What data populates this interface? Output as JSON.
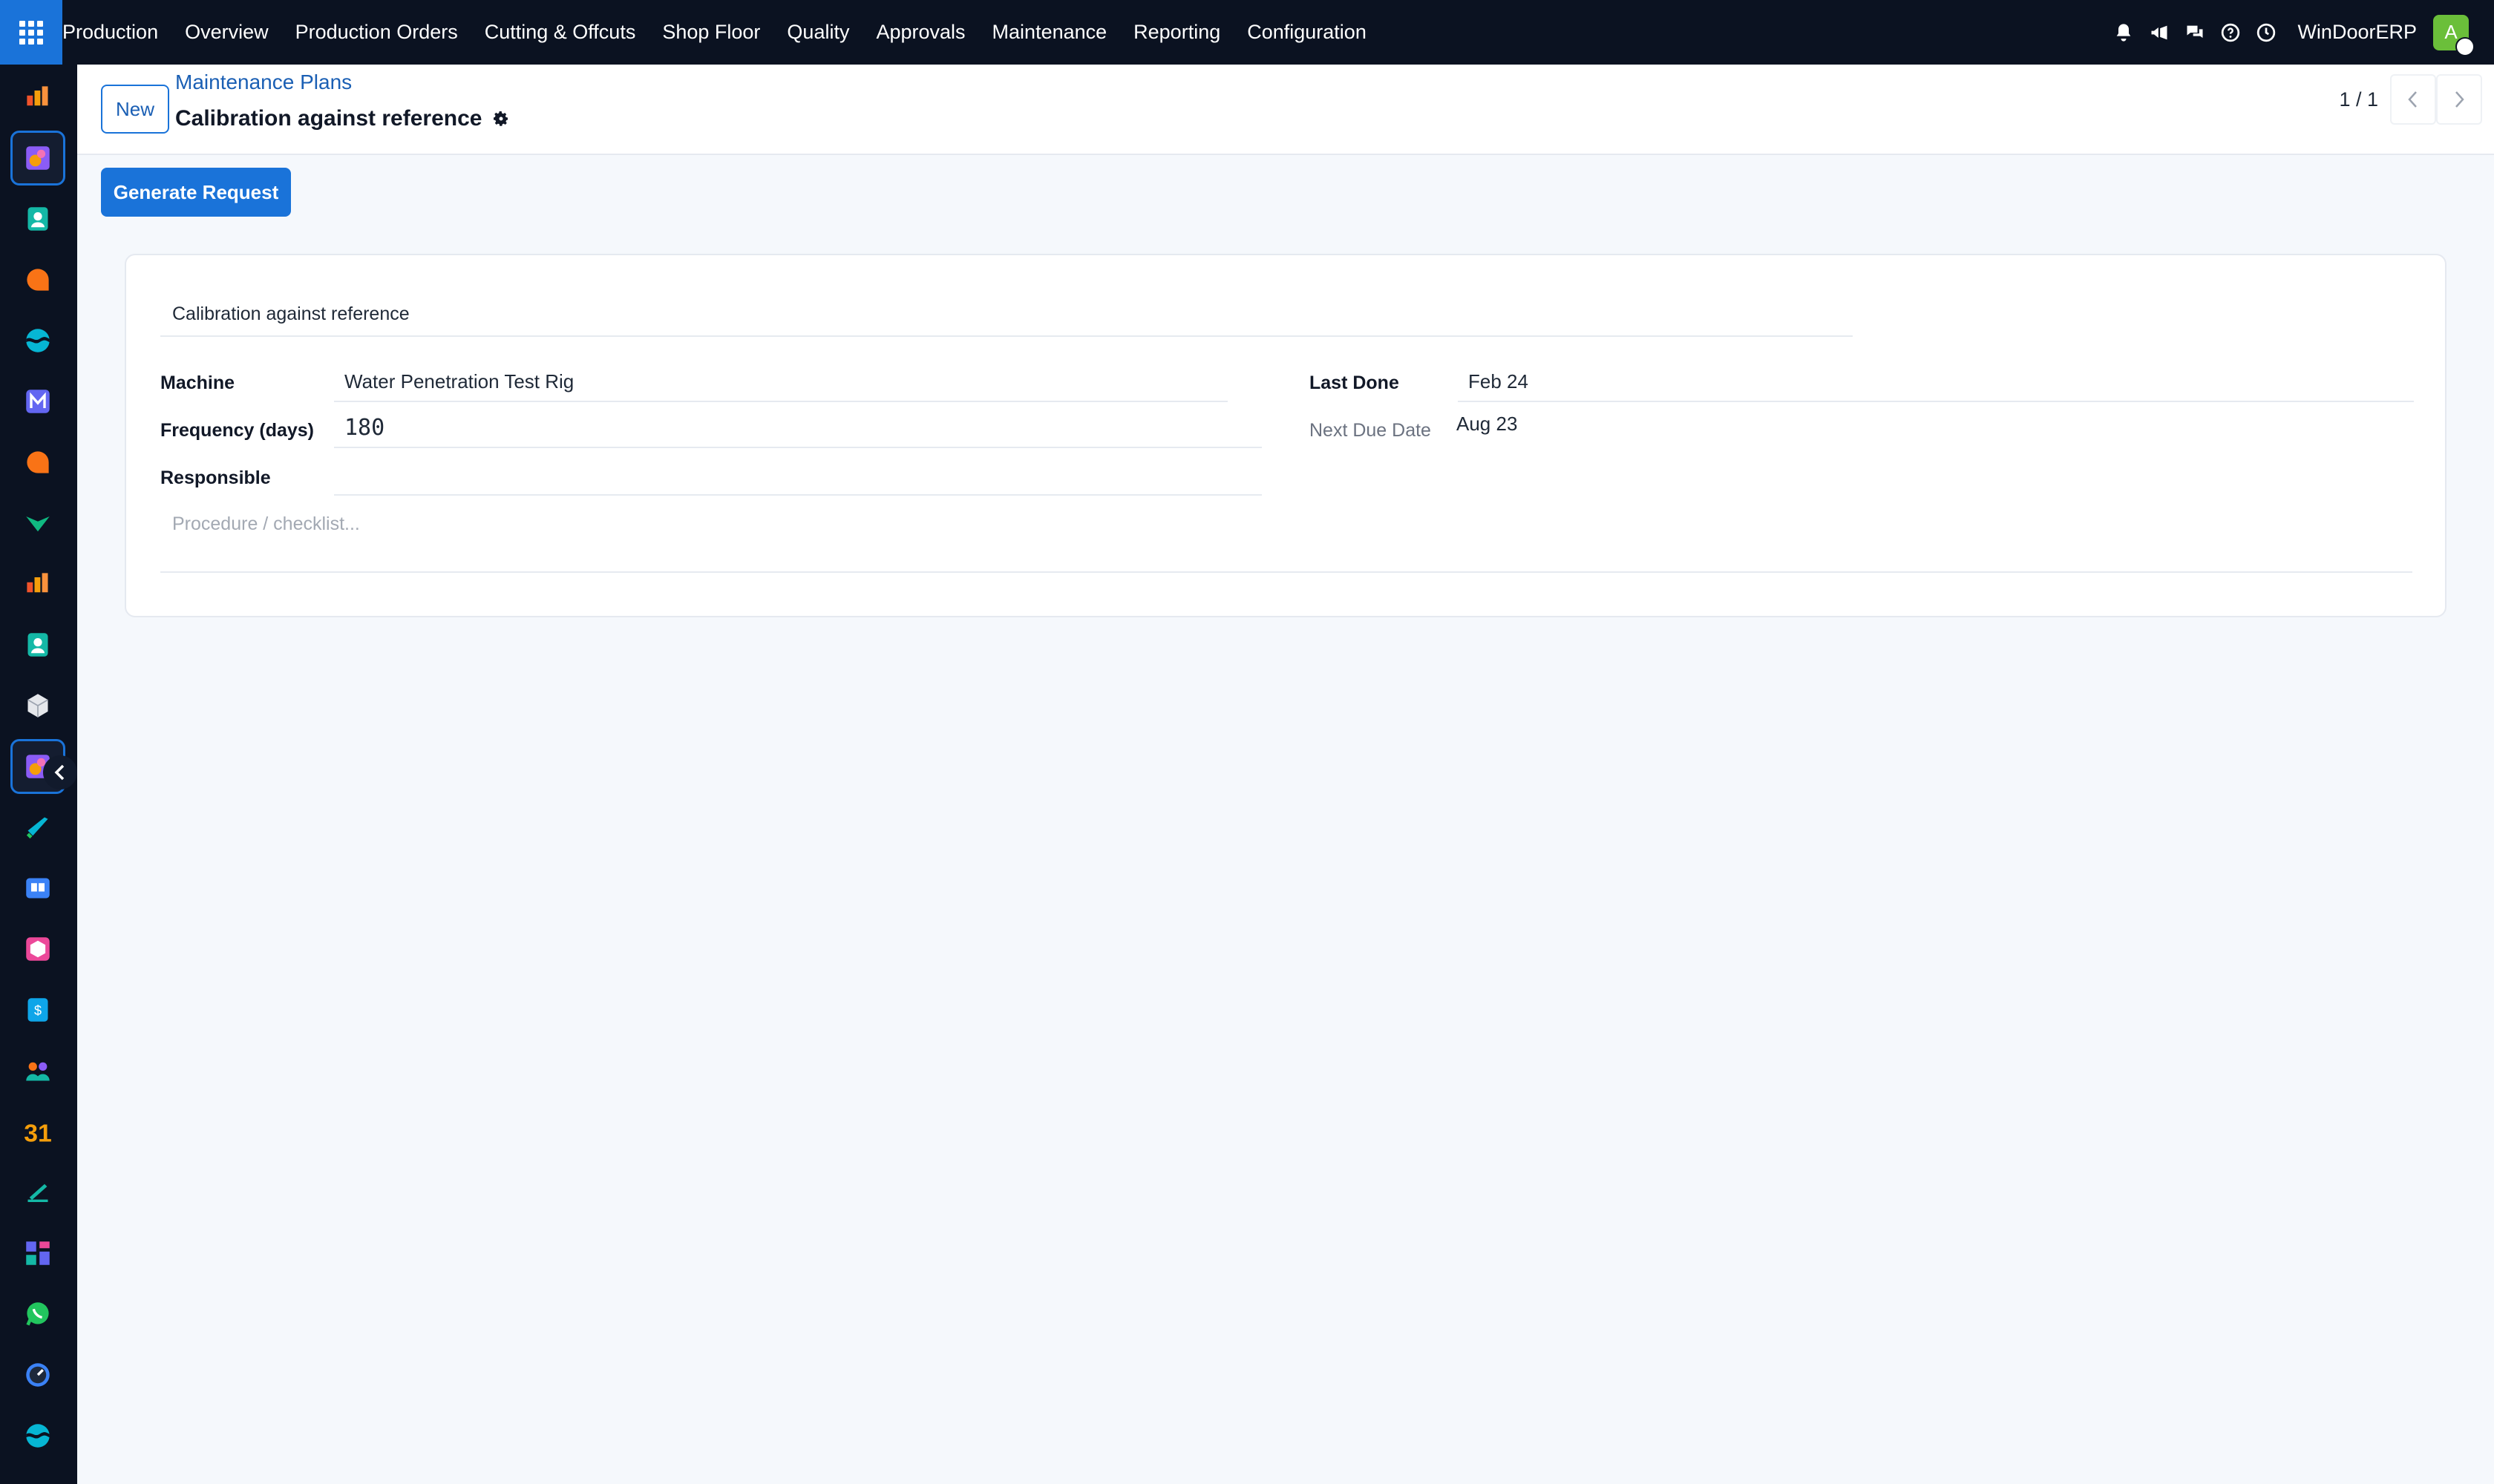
{
  "topbar": {
    "app_name": "Production",
    "menu": [
      "Overview",
      "Production Orders",
      "Cutting & Offcuts",
      "Shop Floor",
      "Quality",
      "Approvals",
      "Maintenance",
      "Reporting",
      "Configuration"
    ],
    "company": "WinDoorERP",
    "avatar_letter": "A"
  },
  "sidebar": {
    "apps": [
      {
        "icon": "bar-chart-icon",
        "color": "#f0532b"
      },
      {
        "icon": "manufacturing-icon",
        "color": "#f59e0b",
        "active": true
      },
      {
        "icon": "contacts-icon",
        "color": "#14b8a6"
      },
      {
        "icon": "chat-bubble-icon",
        "color": "#f97316"
      },
      {
        "icon": "wave-icon",
        "color": "#06b6d4"
      },
      {
        "icon": "mail-icon",
        "color": "#6366f1"
      },
      {
        "icon": "chat-bubble-icon",
        "color": "#f97316"
      },
      {
        "icon": "arrow-check-icon",
        "color": "#10b981"
      },
      {
        "icon": "bar-chart-icon",
        "color": "#f0532b"
      },
      {
        "icon": "contacts-icon",
        "color": "#14b8a6"
      },
      {
        "icon": "cube-icon",
        "color": "#e5e7eb"
      },
      {
        "icon": "manufacturing-icon",
        "color": "#f59e0b",
        "active": true
      },
      {
        "icon": "pencil-check-icon",
        "color": "#06b6d4"
      },
      {
        "icon": "book-icon",
        "color": "#3b82f6"
      },
      {
        "icon": "box-icon",
        "color": "#ec4899"
      },
      {
        "icon": "invoice-icon",
        "color": "#0ea5e9"
      },
      {
        "icon": "team-icon",
        "color": "#f97316"
      },
      {
        "icon": "calendar-icon",
        "color": "#f59e0b",
        "text": "31"
      },
      {
        "icon": "sign-icon",
        "color": "#14b8a6"
      },
      {
        "icon": "dashboard-icon",
        "color": "#6366f1"
      },
      {
        "icon": "whatsapp-icon",
        "color": "#22c55e"
      },
      {
        "icon": "speedometer-icon",
        "color": "#3b82f6"
      },
      {
        "icon": "wave-icon",
        "color": "#06b6d4"
      }
    ]
  },
  "control": {
    "new_label": "New",
    "breadcrumb_parent": "Maintenance Plans",
    "breadcrumb_current": "Calibration against reference",
    "pager": "1 / 1"
  },
  "actions": {
    "generate_request": "Generate Request"
  },
  "form": {
    "name": "Calibration against reference",
    "machine_label": "Machine",
    "machine_value": "Water Penetration Test Rig",
    "frequency_label": "Frequency (days)",
    "frequency_value": "180",
    "responsible_label": "Responsible",
    "responsible_value": "",
    "last_done_label": "Last Done",
    "last_done_value": "Feb 24",
    "next_due_label": "Next Due Date",
    "next_due_value": "Aug 23",
    "notes_placeholder": "Procedure / checklist..."
  }
}
